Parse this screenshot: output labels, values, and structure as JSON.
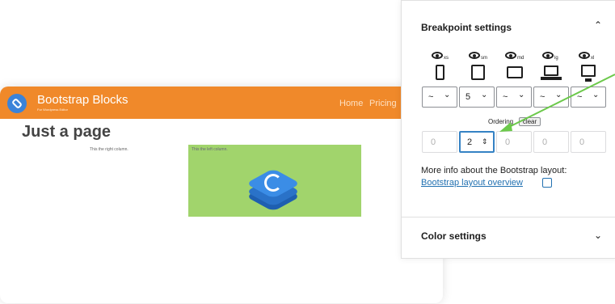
{
  "preview": {
    "brand_title": "Bootstrap Blocks",
    "brand_subtitle": "For Wordpress Editor",
    "nav": [
      "Home",
      "Pricing"
    ],
    "page_title": "Just a page",
    "right_column_text": "This the right column.",
    "left_column_text": "This the left column.",
    "colors": {
      "navbar": "#f0892a",
      "green_column": "#a1d46c",
      "logo_blue": "#3b8de6"
    }
  },
  "panel": {
    "breakpoint_title": "Breakpoint settings",
    "breakpoints": [
      "xs",
      "sm",
      "md",
      "lg",
      "xl"
    ],
    "device_icons": [
      "phone-icon",
      "tablet-icon",
      "tablet-landscape-icon",
      "laptop-icon",
      "desktop-icon"
    ],
    "size_values": [
      "~",
      "5",
      "~",
      "~",
      "~"
    ],
    "ordering_label": "Ordering",
    "clear_label": "clear",
    "order_values": [
      "0",
      "2",
      "0",
      "0",
      "0"
    ],
    "more_info": "More info about the Bootstrap layout:",
    "layout_link": "Bootstrap layout overview",
    "color_title": "Color settings",
    "link_color": "#2271b1",
    "arrow_color": "#6cc94b"
  }
}
